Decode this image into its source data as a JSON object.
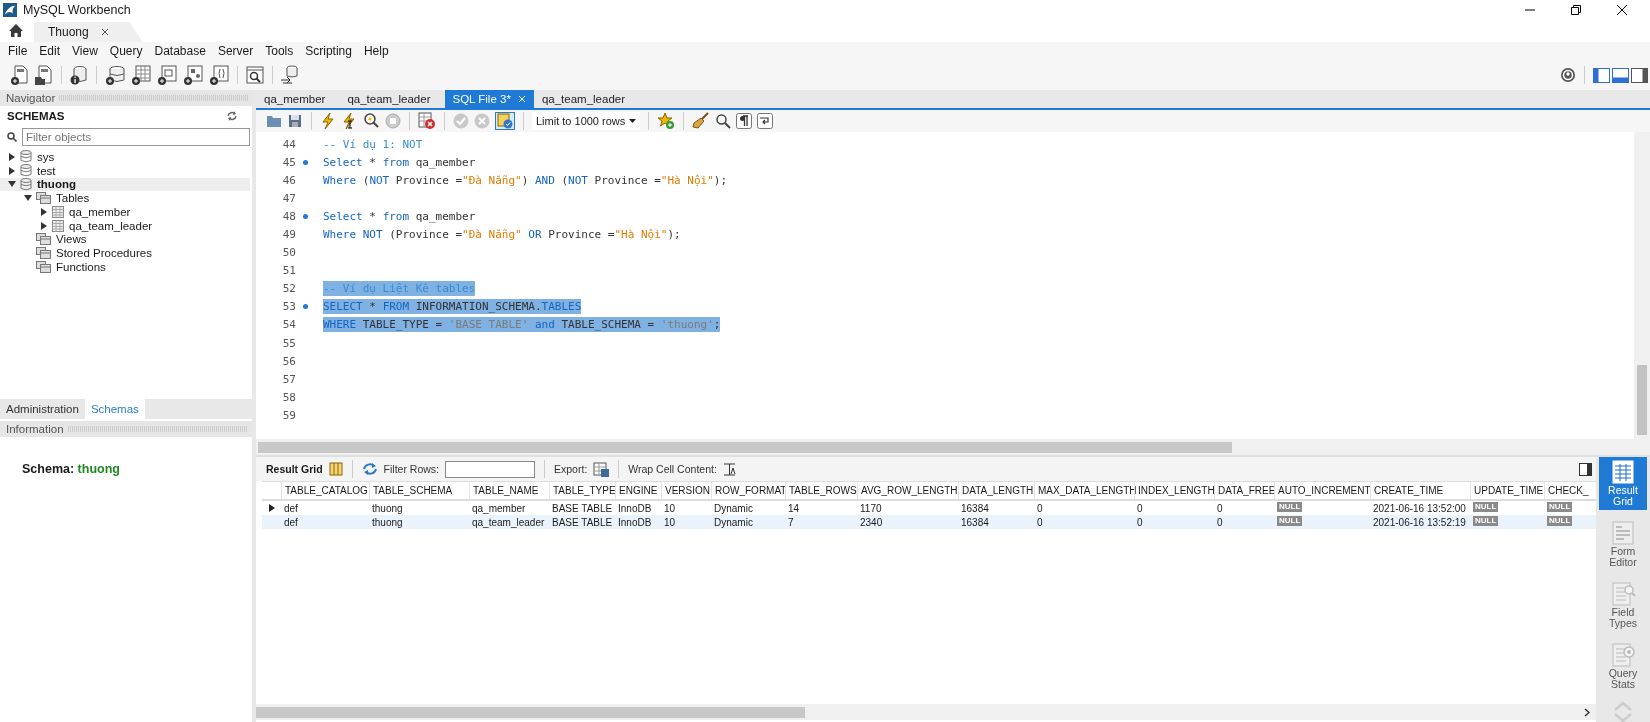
{
  "window": {
    "title": "MySQL Workbench"
  },
  "connection_tabs": [
    {
      "label": "Thuong",
      "selected": true
    }
  ],
  "menu": [
    "File",
    "Edit",
    "View",
    "Query",
    "Database",
    "Server",
    "Tools",
    "Scripting",
    "Help"
  ],
  "panel_toggles": [
    {
      "on": true
    },
    {
      "on": true
    },
    {
      "on": false
    }
  ],
  "navigator": {
    "title": "Navigator",
    "section": "SCHEMAS",
    "filter": {
      "placeholder": "Filter objects"
    },
    "tree": [
      {
        "label": "sys",
        "kind": "schema",
        "selected": false,
        "expanded": false
      },
      {
        "label": "test",
        "kind": "schema",
        "selected": false,
        "expanded": false
      },
      {
        "label": "thuong",
        "kind": "schema",
        "selected": true,
        "expanded": true,
        "children": [
          {
            "label": "Tables",
            "kind": "folder",
            "expanded": true,
            "children": [
              {
                "label": "qa_member",
                "kind": "table",
                "expanded": false
              },
              {
                "label": "qa_team_leader",
                "kind": "table",
                "expanded": false
              }
            ]
          },
          {
            "label": "Views",
            "kind": "folder"
          },
          {
            "label": "Stored Procedures",
            "kind": "folder"
          },
          {
            "label": "Functions",
            "kind": "folder"
          }
        ]
      }
    ],
    "tabs": [
      {
        "label": "Administration",
        "selected": false
      },
      {
        "label": "Schemas",
        "selected": true
      }
    ]
  },
  "information": {
    "title": "Information",
    "label": "Schema:",
    "value": "thuong"
  },
  "editor_tabs": [
    {
      "label": "qa_member",
      "selected": false
    },
    {
      "label": "qa_team_leader",
      "selected": false
    },
    {
      "label": "SQL File 3*",
      "selected": true
    },
    {
      "label": "qa_team_leader",
      "selected": false
    }
  ],
  "editor_toolbar": {
    "continue_on_error": true,
    "limit": "Limit to 1000 rows"
  },
  "editor": {
    "lines": [
      {
        "number": "44",
        "marker": false,
        "selected": false,
        "tokens": [
          {
            "kind": "comment",
            "text": "-- Ví dụ 1: NOT"
          }
        ]
      },
      {
        "number": "45",
        "marker": true,
        "selected": false,
        "tokens": [
          {
            "kind": "keyword",
            "text": "Select"
          },
          {
            "kind": "plain",
            "text": " * "
          },
          {
            "kind": "keyword",
            "text": "from"
          },
          {
            "kind": "plain",
            "text": " qa_member"
          }
        ]
      },
      {
        "number": "46",
        "marker": false,
        "selected": false,
        "tokens": [
          {
            "kind": "keyword",
            "text": "Where"
          },
          {
            "kind": "plain",
            "text": " ("
          },
          {
            "kind": "keyword",
            "text": "NOT"
          },
          {
            "kind": "plain",
            "text": " Province ="
          },
          {
            "kind": "string",
            "text": "\"Đà Nẵng\""
          },
          {
            "kind": "plain",
            "text": ") "
          },
          {
            "kind": "keyword",
            "text": "AND"
          },
          {
            "kind": "plain",
            "text": " ("
          },
          {
            "kind": "keyword",
            "text": "NOT"
          },
          {
            "kind": "plain",
            "text": " Province ="
          },
          {
            "kind": "string",
            "text": "\"Hà Nội\""
          },
          {
            "kind": "plain",
            "text": ");"
          }
        ]
      },
      {
        "number": "47",
        "marker": false
      },
      {
        "number": "48",
        "marker": true,
        "selected": false,
        "tokens": [
          {
            "kind": "keyword",
            "text": "Select"
          },
          {
            "kind": "plain",
            "text": " * "
          },
          {
            "kind": "keyword",
            "text": "from"
          },
          {
            "kind": "plain",
            "text": " qa_member"
          }
        ]
      },
      {
        "number": "49",
        "marker": false,
        "selected": false,
        "tokens": [
          {
            "kind": "keyword",
            "text": "Where"
          },
          {
            "kind": "keyword",
            "text": " NOT"
          },
          {
            "kind": "plain",
            "text": " (Province ="
          },
          {
            "kind": "string",
            "text": "\"Đà Nẵng\""
          },
          {
            "kind": "keyword",
            "text": " OR"
          },
          {
            "kind": "plain",
            "text": " Province ="
          },
          {
            "kind": "string",
            "text": "\"Hà Nội\""
          },
          {
            "kind": "plain",
            "text": ");"
          }
        ]
      },
      {
        "number": "50",
        "marker": false
      },
      {
        "number": "51",
        "marker": false
      },
      {
        "number": "52",
        "marker": false,
        "selected": true,
        "tokens": [
          {
            "kind": "comment",
            "text": "-- Ví dụ Liệt Kê tables"
          }
        ]
      },
      {
        "number": "53",
        "marker": true,
        "selected": true,
        "tokens": [
          {
            "kind": "keyword",
            "text": "SELECT"
          },
          {
            "kind": "plain",
            "text": " * "
          },
          {
            "kind": "keyword",
            "text": "FROM"
          },
          {
            "kind": "plain",
            "text": " INFORMATION_SCHEMA."
          },
          {
            "kind": "keyword",
            "text": "TABLES"
          }
        ]
      },
      {
        "number": "54",
        "marker": false,
        "selected": true,
        "tokens": [
          {
            "kind": "keyword",
            "text": "WHERE"
          },
          {
            "kind": "plain",
            "text": " TABLE_TYPE = "
          },
          {
            "kind": "quoted",
            "text": "'BASE TABLE'"
          },
          {
            "kind": "keyword",
            "text": " and"
          },
          {
            "kind": "plain",
            "text": " TABLE_SCHEMA = "
          },
          {
            "kind": "quoted",
            "text": "'thuong'"
          },
          {
            "kind": "plain",
            "text": ";"
          }
        ]
      },
      {
        "number": "55",
        "marker": false
      },
      {
        "number": "56",
        "marker": false
      },
      {
        "number": "57",
        "marker": false
      },
      {
        "number": "58",
        "marker": false
      },
      {
        "number": "59",
        "marker": false
      }
    ]
  },
  "result": {
    "title": "Result Grid",
    "filter_label": "Filter Rows:",
    "export_label": "Export:",
    "wrap_label": "Wrap Cell Content:",
    "columns": [
      "TABLE_CATALOG",
      "TABLE_SCHEMA",
      "TABLE_NAME",
      "TABLE_TYPE",
      "ENGINE",
      "VERSION",
      "ROW_FORMAT",
      "TABLE_ROWS",
      "AVG_ROW_LENGTH",
      "DATA_LENGTH",
      "MAX_DATA_LENGTH",
      "INDEX_LENGTH",
      "DATA_FREE",
      "AUTO_INCREMENT",
      "CREATE_TIME",
      "UPDATE_TIME",
      "CHECK_"
    ],
    "rows": [
      {
        "selected": true,
        "cells": [
          "def",
          "thuong",
          "qa_member",
          "BASE TABLE",
          "InnoDB",
          "10",
          "Dynamic",
          "14",
          "1170",
          "16384",
          "0",
          "0",
          "0",
          {
            "text": "NULL",
            "kind": "null"
          },
          "2021-06-16 13:52:00",
          {
            "text": "NULL",
            "kind": "null"
          },
          {
            "text": "NULL",
            "kind": "null"
          }
        ]
      },
      {
        "selected": false,
        "cells": [
          "def",
          "thuong",
          "qa_team_leader",
          "BASE TABLE",
          "InnoDB",
          "10",
          "Dynamic",
          "7",
          "2340",
          "16384",
          "0",
          "0",
          "0",
          {
            "text": "NULL",
            "kind": "null"
          },
          "2021-06-16 13:52:19",
          {
            "text": "NULL",
            "kind": "null"
          },
          {
            "text": "NULL",
            "kind": "null"
          }
        ]
      }
    ]
  },
  "side_tabs": [
    {
      "label": "Result Grid",
      "kind": "grid",
      "selected": true
    },
    {
      "label": "Form Editor",
      "kind": "form",
      "selected": false
    },
    {
      "label": "Field Types",
      "kind": "fields",
      "selected": false
    },
    {
      "label": "Query Stats",
      "kind": "stats",
      "selected": false
    }
  ]
}
